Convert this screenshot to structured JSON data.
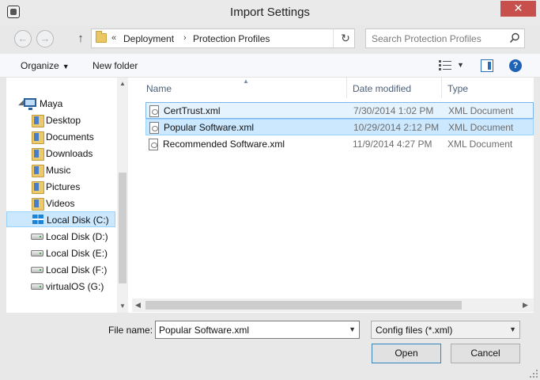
{
  "window": {
    "title": "Import Settings",
    "close_glyph": "✕"
  },
  "nav": {
    "back_glyph": "←",
    "forward_glyph": "→",
    "up_glyph": "↑"
  },
  "address": {
    "overflow_glyph": "«",
    "crumbs": [
      "Deployment",
      "Protection Profiles"
    ],
    "separator_glyph": "›",
    "refresh_glyph": "↻"
  },
  "search": {
    "placeholder": "Search Protection Profiles"
  },
  "toolbar": {
    "organize_label": "Organize",
    "new_folder_label": "New folder",
    "caret_glyph": "▼",
    "help_glyph": "?"
  },
  "tree": {
    "items": [
      {
        "label": "Maya",
        "icon": "computer-icon"
      },
      {
        "label": "Desktop",
        "icon": "folder-icon"
      },
      {
        "label": "Documents",
        "icon": "folder-icon"
      },
      {
        "label": "Downloads",
        "icon": "folder-icon"
      },
      {
        "label": "Music",
        "icon": "folder-icon"
      },
      {
        "label": "Pictures",
        "icon": "folder-icon"
      },
      {
        "label": "Videos",
        "icon": "folder-icon"
      },
      {
        "label": "Local Disk (C:)",
        "icon": "windows-drive-icon",
        "selected": true
      },
      {
        "label": "Local Disk (D:)",
        "icon": "drive-icon"
      },
      {
        "label": "Local Disk (E:)",
        "icon": "drive-icon"
      },
      {
        "label": "Local Disk (F:)",
        "icon": "drive-icon"
      },
      {
        "label": "virtualOS (G:)",
        "icon": "drive-icon"
      }
    ]
  },
  "files": {
    "columns": [
      "Name",
      "Date modified",
      "Type"
    ],
    "rows": [
      {
        "name": "CertTrust.xml",
        "date": "7/30/2014 1:02 PM",
        "type": "XML Document",
        "state": "hover"
      },
      {
        "name": "Popular Software.xml",
        "date": "10/29/2014 2:12 PM",
        "type": "XML Document",
        "state": "selected"
      },
      {
        "name": "Recommended Software.xml",
        "date": "11/9/2014 4:27 PM",
        "type": "XML Document",
        "state": ""
      }
    ]
  },
  "footer": {
    "file_name_label": "File name:",
    "file_name_value": "Popular Software.xml",
    "file_type_value": "Config files (*.xml)",
    "open_label": "Open",
    "cancel_label": "Cancel"
  },
  "colors": {
    "selection_bg": "#cce8ff",
    "selection_border": "#99d1ff",
    "close_red": "#c7504c"
  }
}
